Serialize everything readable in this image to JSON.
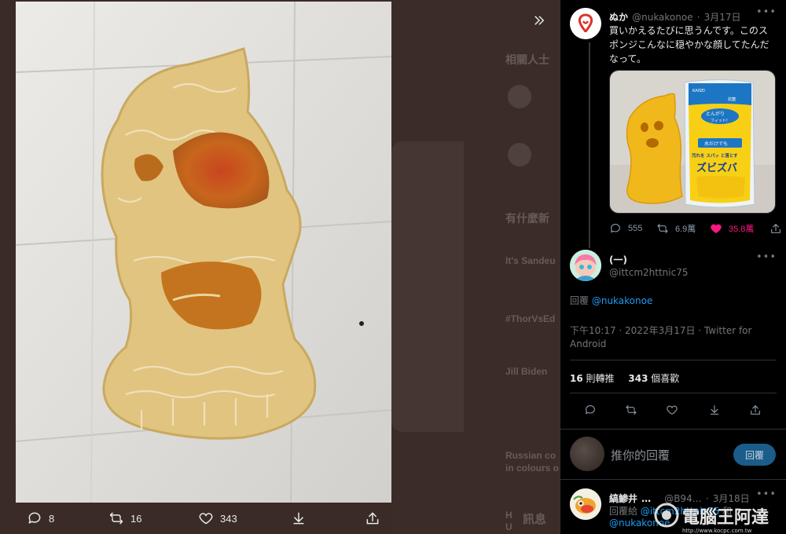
{
  "background_ui": {
    "heading_related": "相關人士",
    "heading_trending": "有什麼新",
    "trend1_title": "It's Sandeu",
    "trend2_title": "#ThorVsEd",
    "trend3_title": "Jill Biden",
    "trend4_title": "Russian co",
    "trend4_sub": "in colours o",
    "messages_label": "訊息",
    "letters": [
      "H",
      "U"
    ]
  },
  "media": {
    "reply_count": "8",
    "retweet_count": "16",
    "like_count": "343"
  },
  "original_tweet": {
    "display_name": "ぬか",
    "handle": "@nukakonoe",
    "sep": "·",
    "date": "3月17日",
    "text": "買いかえるたびに思うんです。このスポンジこんなに穏やかな顔してたんだなって。",
    "reply_count": "555",
    "retweet_count": "6.9萬",
    "like_count": "35.8萬",
    "product_labels": {
      "top_tag": "とんがり",
      "fit": "フィット!",
      "brand": "KAISEI",
      "water": "水だけでも",
      "dirt": "汚れを スパッ と落とす",
      "name": "ズビズバ",
      "antibac": "抗菌"
    }
  },
  "main_tweet": {
    "display_name": "(一)",
    "handle": "@ittcm2httnic75",
    "reply_prefix": "回覆",
    "reply_to": "@nukakonoe",
    "timestamp": "下午10:17 · 2022年3月17日 · Twitter for Android",
    "retweets_num": "16",
    "retweets_label": "則轉推",
    "likes_num": "343",
    "likes_label": "個喜歡"
  },
  "composer": {
    "placeholder": "推你的回覆",
    "reply_button": "回覆"
  },
  "next_reply": {
    "display_name": "縞鯵井",
    "name_suffix": "…",
    "handle": "@B94…",
    "sep": "·",
    "date": "3月18日",
    "reply_prefix": "回覆給",
    "reply_to_1": "@ittcm2httnic75",
    "reply_to_conj": "和",
    "reply_to_2": "@nukakonoe"
  },
  "watermark": {
    "text": "電腦王阿達",
    "url": "http://www.kocpc.com.tw"
  },
  "colors": {
    "panel_bg": "#000000",
    "link": "#1d9bf0",
    "like_pink": "#f91880",
    "viewer_bg": "#3a2b27"
  }
}
